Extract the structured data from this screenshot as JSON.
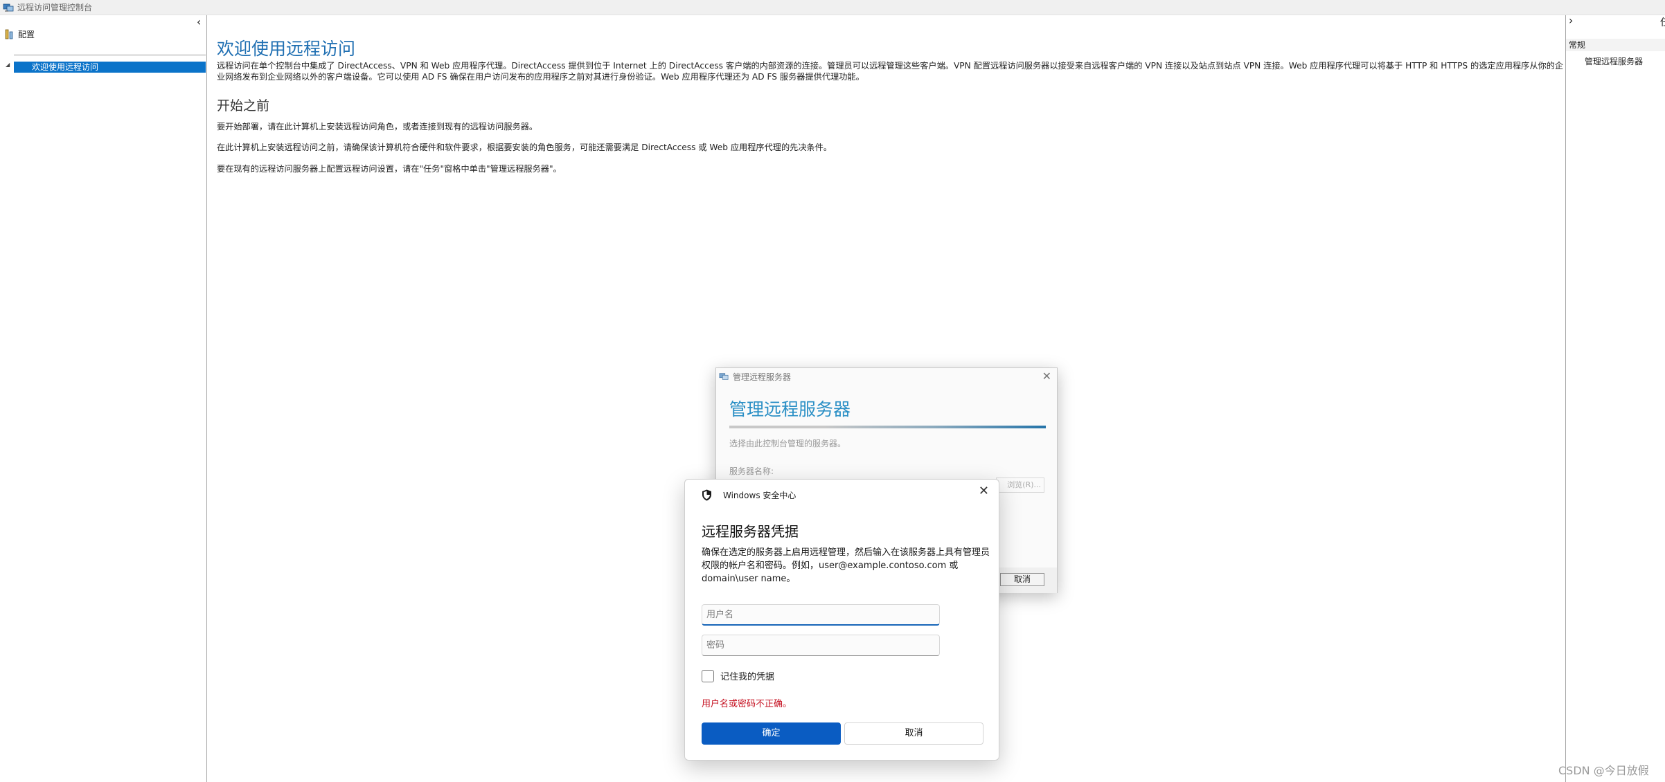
{
  "window": {
    "title": "远程访问管理控制台"
  },
  "tree": {
    "root_label": "配置",
    "selected_item": "欢迎使用远程访问"
  },
  "main": {
    "title": "欢迎使用远程访问",
    "intro": "远程访问在单个控制台中集成了 DirectAccess、VPN 和 Web 应用程序代理。DirectAccess 提供到位于 Internet 上的 DirectAccess 客户端的内部资源的连接。管理员可以远程管理这些客户端。VPN 配置远程访问服务器以接受来自远程客户端的 VPN 连接以及站点到站点 VPN 连接。Web 应用程序代理可以将基于 HTTP 和 HTTPS 的选定应用程序从你的企业网络发布到企业网络以外的客户端设备。它可以使用 AD FS 确保在用户访问发布的应用程序之前对其进行身份验证。Web 应用程序代理还为 AD FS 服务器提供代理功能。",
    "section_title": "开始之前",
    "para1": "要开始部署，请在此计算机上安装远程访问角色，或者连接到现有的远程访问服务器。",
    "para2": "在此计算机上安装远程访问之前，请确保该计算机符合硬件和软件要求，根据要安装的角色服务，可能还需要满足 DirectAccess 或 Web 应用程序代理的先决条件。",
    "para3": "要在现有的远程访问服务器上配置远程访问设置，请在\"任务\"窗格中单击\"管理远程服务器\"。"
  },
  "actions": {
    "header": "常规",
    "item": "管理远程服务器",
    "top_glyph": "任"
  },
  "wizard": {
    "title": "管理远程服务器",
    "heading": "管理远程服务器",
    "description": "选择由此控制台管理的服务器。",
    "server_label": "服务器名称:",
    "browse_label": "浏览(R)...",
    "cancel_label": "取消"
  },
  "credential_dialog": {
    "source": "Windows 安全中心",
    "title": "远程服务器凭据",
    "description": "确保在选定的服务器上启用远程管理，然后输入在该服务器上具有管理员权限的帐户名和密码。例如，user@example.contoso.com 或 domain\\user name。",
    "username_placeholder": "用户名",
    "username_value": "",
    "password_placeholder": "密码",
    "password_value": "",
    "remember_label": "记住我的凭据",
    "remember_checked": false,
    "error_text": "用户名或密码不正确。",
    "ok_label": "确定",
    "cancel_label": "取消"
  },
  "watermark": "CSDN @今日放假",
  "icons": {
    "collapse_left": "chevron-left-icon",
    "expand_right": "chevron-right-icon",
    "close": "close-icon",
    "shield": "shield-icon"
  },
  "colors": {
    "accent": "#1f6fb2",
    "selection": "#0b73c9",
    "primary_button": "#0a5cc2",
    "error": "#c50f1f"
  }
}
